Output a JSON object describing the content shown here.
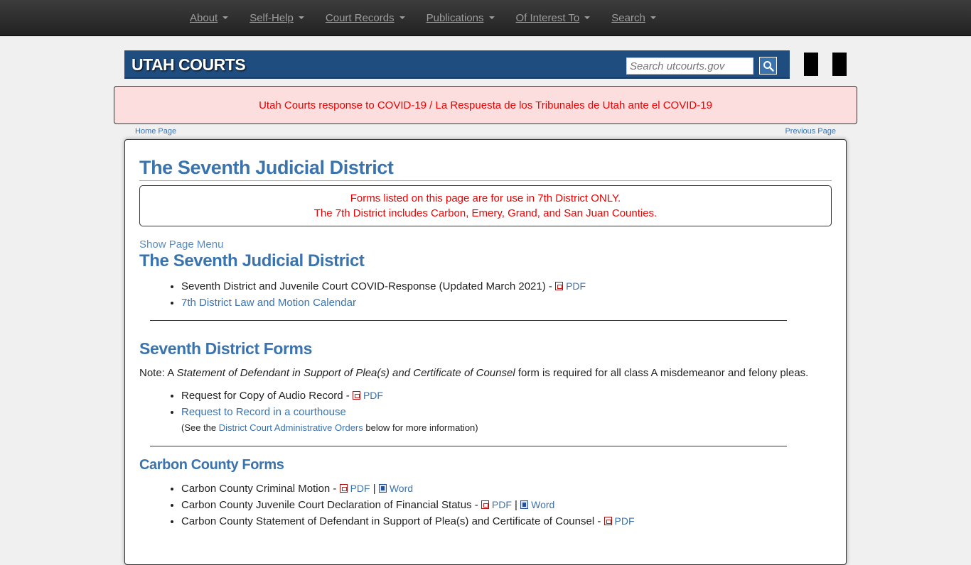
{
  "nav": {
    "items": [
      {
        "label": "About"
      },
      {
        "label": "Self-Help"
      },
      {
        "label": "Court Records"
      },
      {
        "label": "Publications"
      },
      {
        "label": "Of Interest To"
      },
      {
        "label": "Search"
      }
    ]
  },
  "banner": {
    "logo": "UTAH COURTS",
    "search_placeholder": "Search utcourts.gov"
  },
  "covid_notice": "Utah Courts response to COVID-19 / La Respuesta de los Tribunales de Utah ante el COVID-19",
  "crumbs": {
    "home": "Home Page",
    "previous": "Previous Page"
  },
  "page": {
    "title": "The Seventh Judicial District",
    "notice_line1": "Forms listed on this page are for use in 7th District ONLY.",
    "notice_line2": "The 7th District includes Carbon, Emery, Grand, and San Juan Counties.",
    "show_menu": "Show Page Menu"
  },
  "section1": {
    "heading": "The Seventh Judicial District",
    "item1_text": "Seventh District and Juvenile Court COVID-Response (Updated March 2021) - ",
    "item1_pdf": "PDF",
    "item2_link": "7th District Law and Motion Calendar"
  },
  "section2": {
    "heading": "Seventh District Forms",
    "note_prefix": "Note: A ",
    "note_italic": "Statement of Defendant in Support of Plea(s) and Certificate of Counsel",
    "note_suffix": " form is required for all class A misdemeanor and felony pleas.",
    "item1_text": "Request for Copy of Audio Record - ",
    "item1_pdf": "PDF",
    "item2_link": "Request to Record in a courthouse",
    "see_prefix": "(See the ",
    "see_link": "District Court Administrative Orders",
    "see_suffix": " below for more information)"
  },
  "section3": {
    "heading": "Carbon County Forms",
    "item1_text": "Carbon County Criminal Motion - ",
    "item1_pdf": "PDF",
    "item1_word": "Word",
    "item2_text": "Carbon County Juvenile Court Declaration of Financial Status - ",
    "item2_pdf": "PDF",
    "item2_word": "Word",
    "item3_text": "Carbon County Statement of Defendant in Support of Plea(s) and Certificate of Counsel - ",
    "item3_pdf": "PDF",
    "separator": " | "
  },
  "colors": {
    "nav_bg": "#222222",
    "banner_bg": "#1f4d7f",
    "link": "#3b73ad",
    "alert_text": "#ee0000",
    "covid_bg": "#fddede"
  }
}
